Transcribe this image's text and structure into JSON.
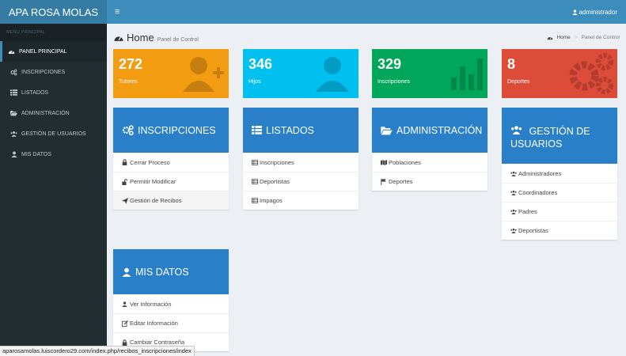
{
  "app": {
    "brand": "APA ROSA MOLAS",
    "menu_toggle": "≡",
    "user": "administrador"
  },
  "sidebar": {
    "header": "MENU PRINCIPAL",
    "items": [
      {
        "label": "PANEL PRINCIPAL",
        "icon": "dashboard-icon",
        "active": true
      },
      {
        "label": "INSCRIPCIONES",
        "icon": "cogs-icon"
      },
      {
        "label": "LISTADOS",
        "icon": "list-icon"
      },
      {
        "label": "ADMINISTRACIÓN",
        "icon": "folder-open-icon"
      },
      {
        "label": "GESTIÓN DE USUARIOS",
        "icon": "users-icon"
      },
      {
        "label": "MIS DATOS",
        "icon": "user-icon"
      }
    ]
  },
  "header": {
    "title": "Home",
    "subtitle": "Panel de Control",
    "breadcrumb": [
      "Home",
      "Panel de Control"
    ]
  },
  "stats": [
    {
      "value": "272",
      "label": "Tutores",
      "color": "#f39c12",
      "icon": "user-plus-icon"
    },
    {
      "value": "346",
      "label": "Hijos",
      "color": "#00c0ef",
      "icon": "user-icon"
    },
    {
      "value": "329",
      "label": "Inscripciones",
      "color": "#00a65a",
      "icon": "bar-chart-icon"
    },
    {
      "value": "8",
      "label": "Deportes",
      "color": "#dd4b39",
      "icon": "gears-icon"
    }
  ],
  "panels": {
    "inscripciones": {
      "title": "INSCRIPCIONES",
      "items": [
        "Cerrar Proceso",
        "Permitir Modificar",
        "Gestión de Recibos"
      ]
    },
    "listados": {
      "title": "LISTADOS",
      "items": [
        "Inscripciones",
        "Deportistas",
        "Impagos"
      ]
    },
    "administracion": {
      "title": "ADMINISTRACIÓN",
      "items": [
        "Poblaciones",
        "Deportes"
      ]
    },
    "gestion": {
      "title_line1": "GESTIÓN DE",
      "title_line2": "USUARIOS",
      "items": [
        "Administradores",
        "Coordinadores",
        "Padres",
        "Deportistas"
      ]
    },
    "misdatos": {
      "title": "MIS DATOS",
      "items": [
        "Ver Información",
        "Editar Información",
        "Cambiar Contraseña"
      ]
    }
  },
  "status_url": "aparosamolas.luiscordero29.com/index.php/recibos_inscripciones/index"
}
